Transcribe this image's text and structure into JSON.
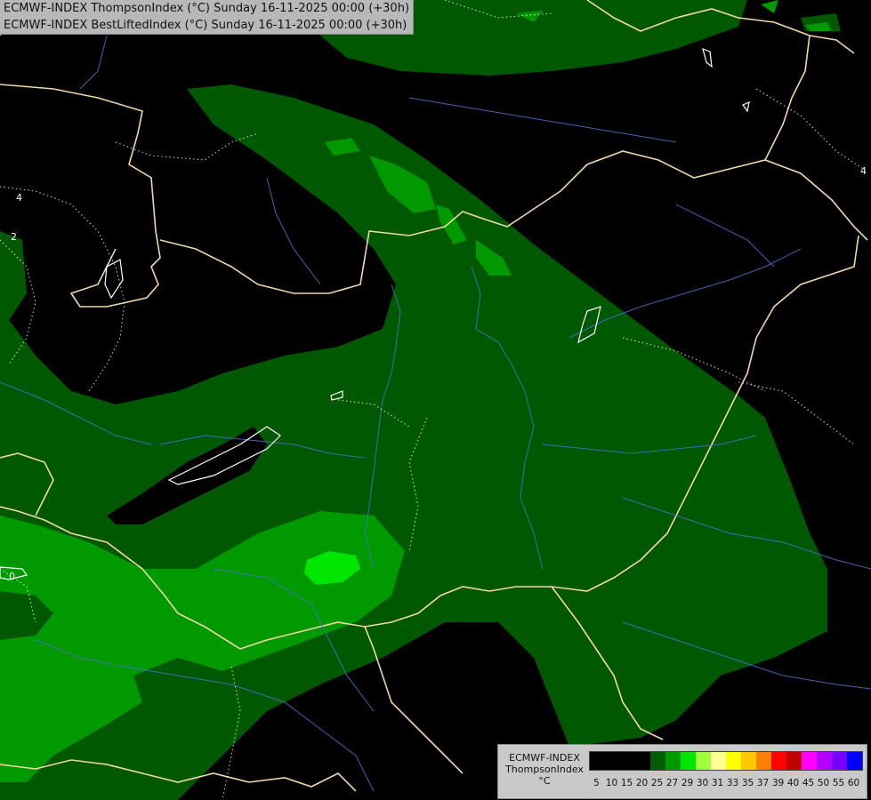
{
  "header": {
    "line1": "ECMWF-INDEX ThompsonIndex (°C) Sunday 16-11-2025 00:00 (+30h)",
    "line2": "ECMWF-INDEX BestLiftedIndex (°C) Sunday 16-11-2025 00:00 (+30h)"
  },
  "contour_labels": [
    "4",
    "2",
    "0",
    "4"
  ],
  "legend": {
    "label_line1": "ECMWF-INDEX",
    "label_line2": "ThompsonIndex",
    "label_line3": "°C",
    "classes": [
      {
        "value": "5",
        "color": "#000000"
      },
      {
        "value": "10",
        "color": "#000000"
      },
      {
        "value": "15",
        "color": "#000000"
      },
      {
        "value": "20",
        "color": "#000000"
      },
      {
        "value": "25",
        "color": "#005e00"
      },
      {
        "value": "27",
        "color": "#009a00"
      },
      {
        "value": "29",
        "color": "#00e600"
      },
      {
        "value": "30",
        "color": "#a0ff3c"
      },
      {
        "value": "31",
        "color": "#ffff96"
      },
      {
        "value": "33",
        "color": "#ffff00"
      },
      {
        "value": "35",
        "color": "#ffc800"
      },
      {
        "value": "37",
        "color": "#ff8000"
      },
      {
        "value": "39",
        "color": "#ff0000"
      },
      {
        "value": "40",
        "color": "#c00000"
      },
      {
        "value": "45",
        "color": "#ff00ff"
      },
      {
        "value": "50",
        "color": "#b400ff"
      },
      {
        "value": "55",
        "color": "#7800ff"
      },
      {
        "value": "60",
        "color": "#0000ff"
      }
    ]
  }
}
